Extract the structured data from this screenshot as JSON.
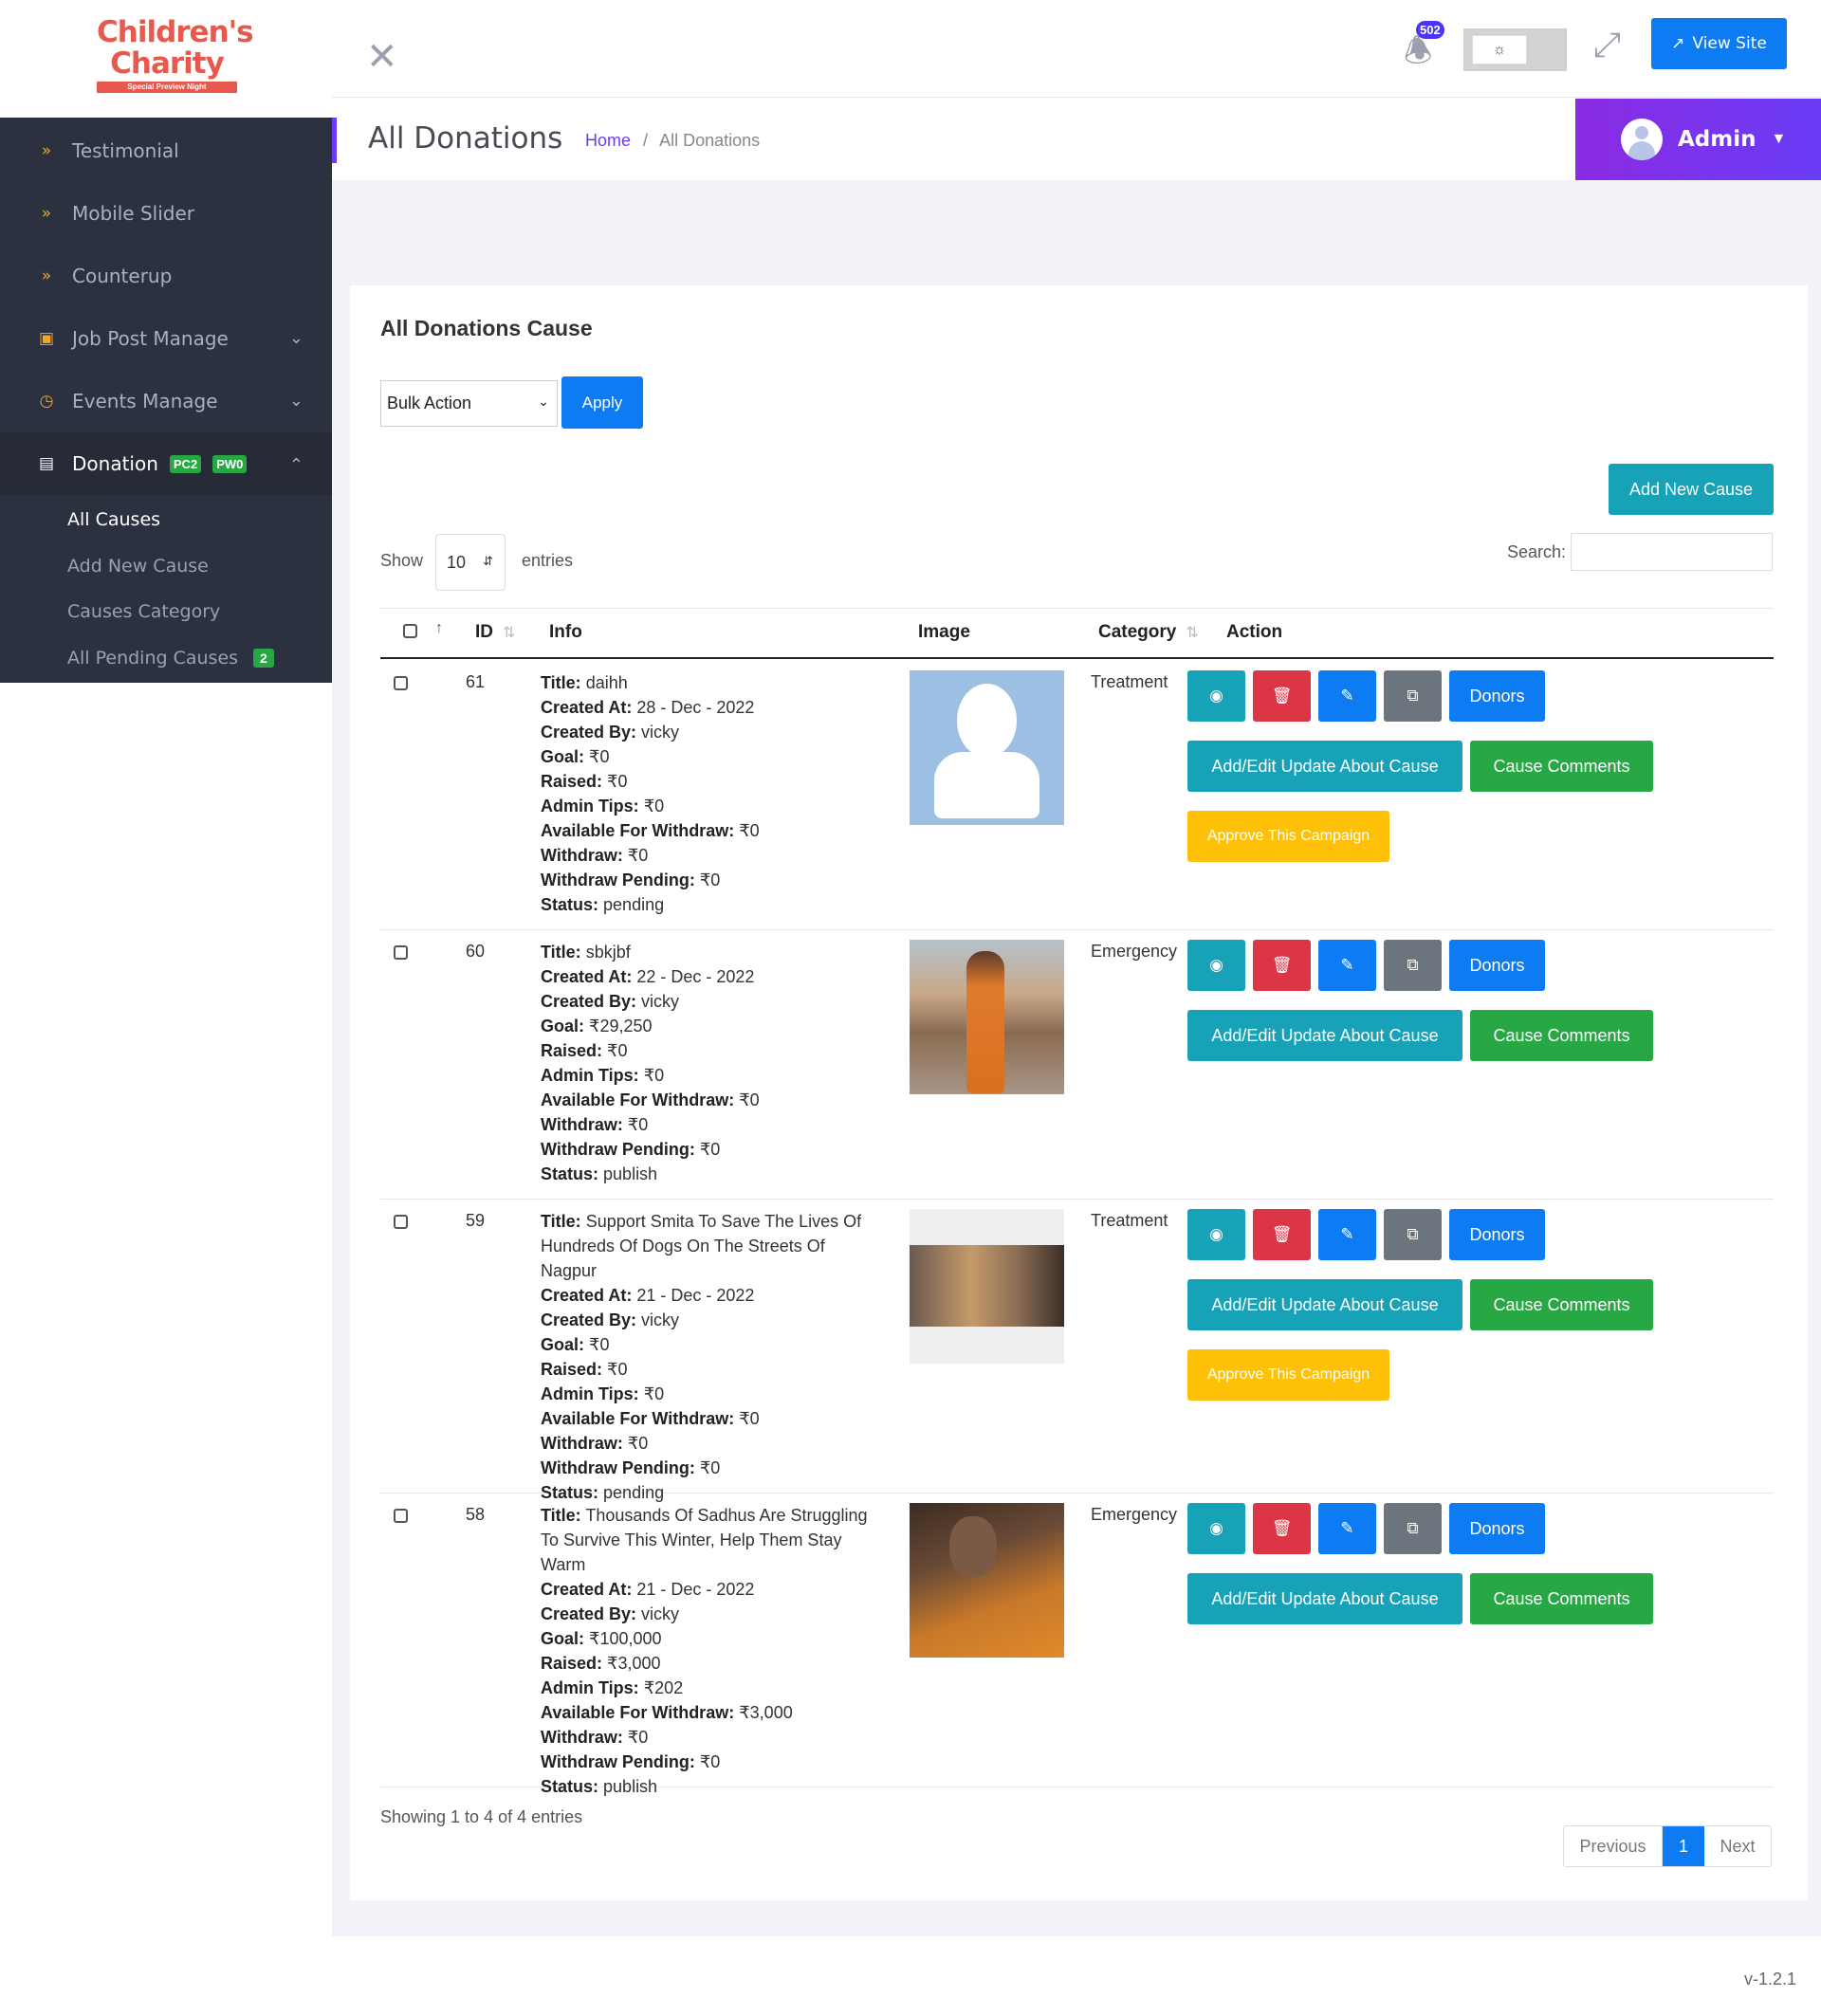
{
  "brand": {
    "line1": "Children's",
    "line2": "Charity",
    "tagline": "Special Preview Night"
  },
  "sidebar": {
    "items": [
      {
        "label": "Testimonial",
        "icon": "double-chevron-right-icon"
      },
      {
        "label": "Mobile Slider",
        "icon": "double-chevron-right-icon"
      },
      {
        "label": "Counterup",
        "icon": "double-chevron-right-icon"
      },
      {
        "label": "Job Post Manage",
        "icon": "box-icon"
      },
      {
        "label": "Events Manage",
        "icon": "clock-icon"
      },
      {
        "label": "Donation",
        "icon": "book-icon",
        "badge1": "PC2",
        "badge2": "PW0"
      }
    ],
    "submenu": [
      {
        "label": "All Causes"
      },
      {
        "label": "Add New Cause"
      },
      {
        "label": "Causes Category"
      },
      {
        "label": "All Pending Causes",
        "badge": "2"
      }
    ]
  },
  "header": {
    "notification_count": "502",
    "view_site": "View Site",
    "page_title": "All Donations",
    "breadcrumb": {
      "home": "Home",
      "current": "All Donations"
    },
    "admin_name": "Admin"
  },
  "colors": {
    "primary": "#0d7cf2",
    "info": "#17a2b8",
    "danger": "#dc3545",
    "success": "#28a745",
    "warning": "#ffc107",
    "accent": "#6a3cf7"
  },
  "card": {
    "title": "All Donations Cause",
    "bulk_action": "Bulk Action",
    "apply": "Apply",
    "add_new_cause": "Add New Cause",
    "show": "Show",
    "entries_value": "10",
    "entries": "entries",
    "search_label": "Search:"
  },
  "table": {
    "headers": {
      "id": "ID",
      "info": "Info",
      "image": "Image",
      "category": "Category",
      "action": "Action"
    },
    "labels": {
      "title": "Title:",
      "created_at": "Created At:",
      "created_by": "Created By:",
      "goal": "Goal:",
      "raised": "Raised:",
      "admin_tips": "Admin Tips:",
      "available": "Available For Withdraw:",
      "withdraw": "Withdraw:",
      "withdraw_pending": "Withdraw Pending:",
      "status": "Status:"
    },
    "buttons": {
      "donors": "Donors",
      "update": "Add/Edit Update About Cause",
      "comments": "Cause Comments",
      "approve": "Approve This Campaign"
    },
    "rows": [
      {
        "id": "61",
        "title": "daihh",
        "created_at": "28 - Dec - 2022",
        "created_by": "vicky",
        "goal": "₹0",
        "raised": "₹0",
        "admin_tips": "₹0",
        "available": "₹0",
        "withdraw": "₹0",
        "withdraw_pending": "₹0",
        "status": "pending",
        "category": "Treatment",
        "image": "avatar-placeholder"
      },
      {
        "id": "60",
        "title": "sbkjbf",
        "created_at": "22 - Dec - 2022",
        "created_by": "vicky",
        "goal": "₹29,250",
        "raised": "₹0",
        "admin_tips": "₹0",
        "available": "₹0",
        "withdraw": "₹0",
        "withdraw_pending": "₹0",
        "status": "publish",
        "category": "Emergency",
        "image": "sadhu-walking-photo"
      },
      {
        "id": "59",
        "title": "Support Smita To Save The Lives Of Hundreds Of Dogs On The Streets Of Nagpur",
        "created_at": "21 - Dec - 2022",
        "created_by": "vicky",
        "goal": "₹0",
        "raised": "₹0",
        "admin_tips": "₹0",
        "available": "₹0",
        "withdraw": "₹0",
        "withdraw_pending": "₹0",
        "status": "pending",
        "category": "Treatment",
        "image": "dogs-photo"
      },
      {
        "id": "58",
        "title": "Thousands Of Sadhus Are Struggling To Survive This Winter, Help Them Stay Warm",
        "created_at": "21 - Dec - 2022",
        "created_by": "vicky",
        "goal": "₹100,000",
        "raised": "₹3,000",
        "admin_tips": "₹202",
        "available": "₹3,000",
        "withdraw": "₹0",
        "withdraw_pending": "₹0",
        "status": "publish",
        "category": "Emergency",
        "image": "sadhu-sitting-photo"
      }
    ]
  },
  "footer": {
    "showing": "Showing 1 to 4 of 4 entries",
    "previous": "Previous",
    "current_page": "1",
    "next": "Next",
    "version": "v-1.2.1"
  }
}
